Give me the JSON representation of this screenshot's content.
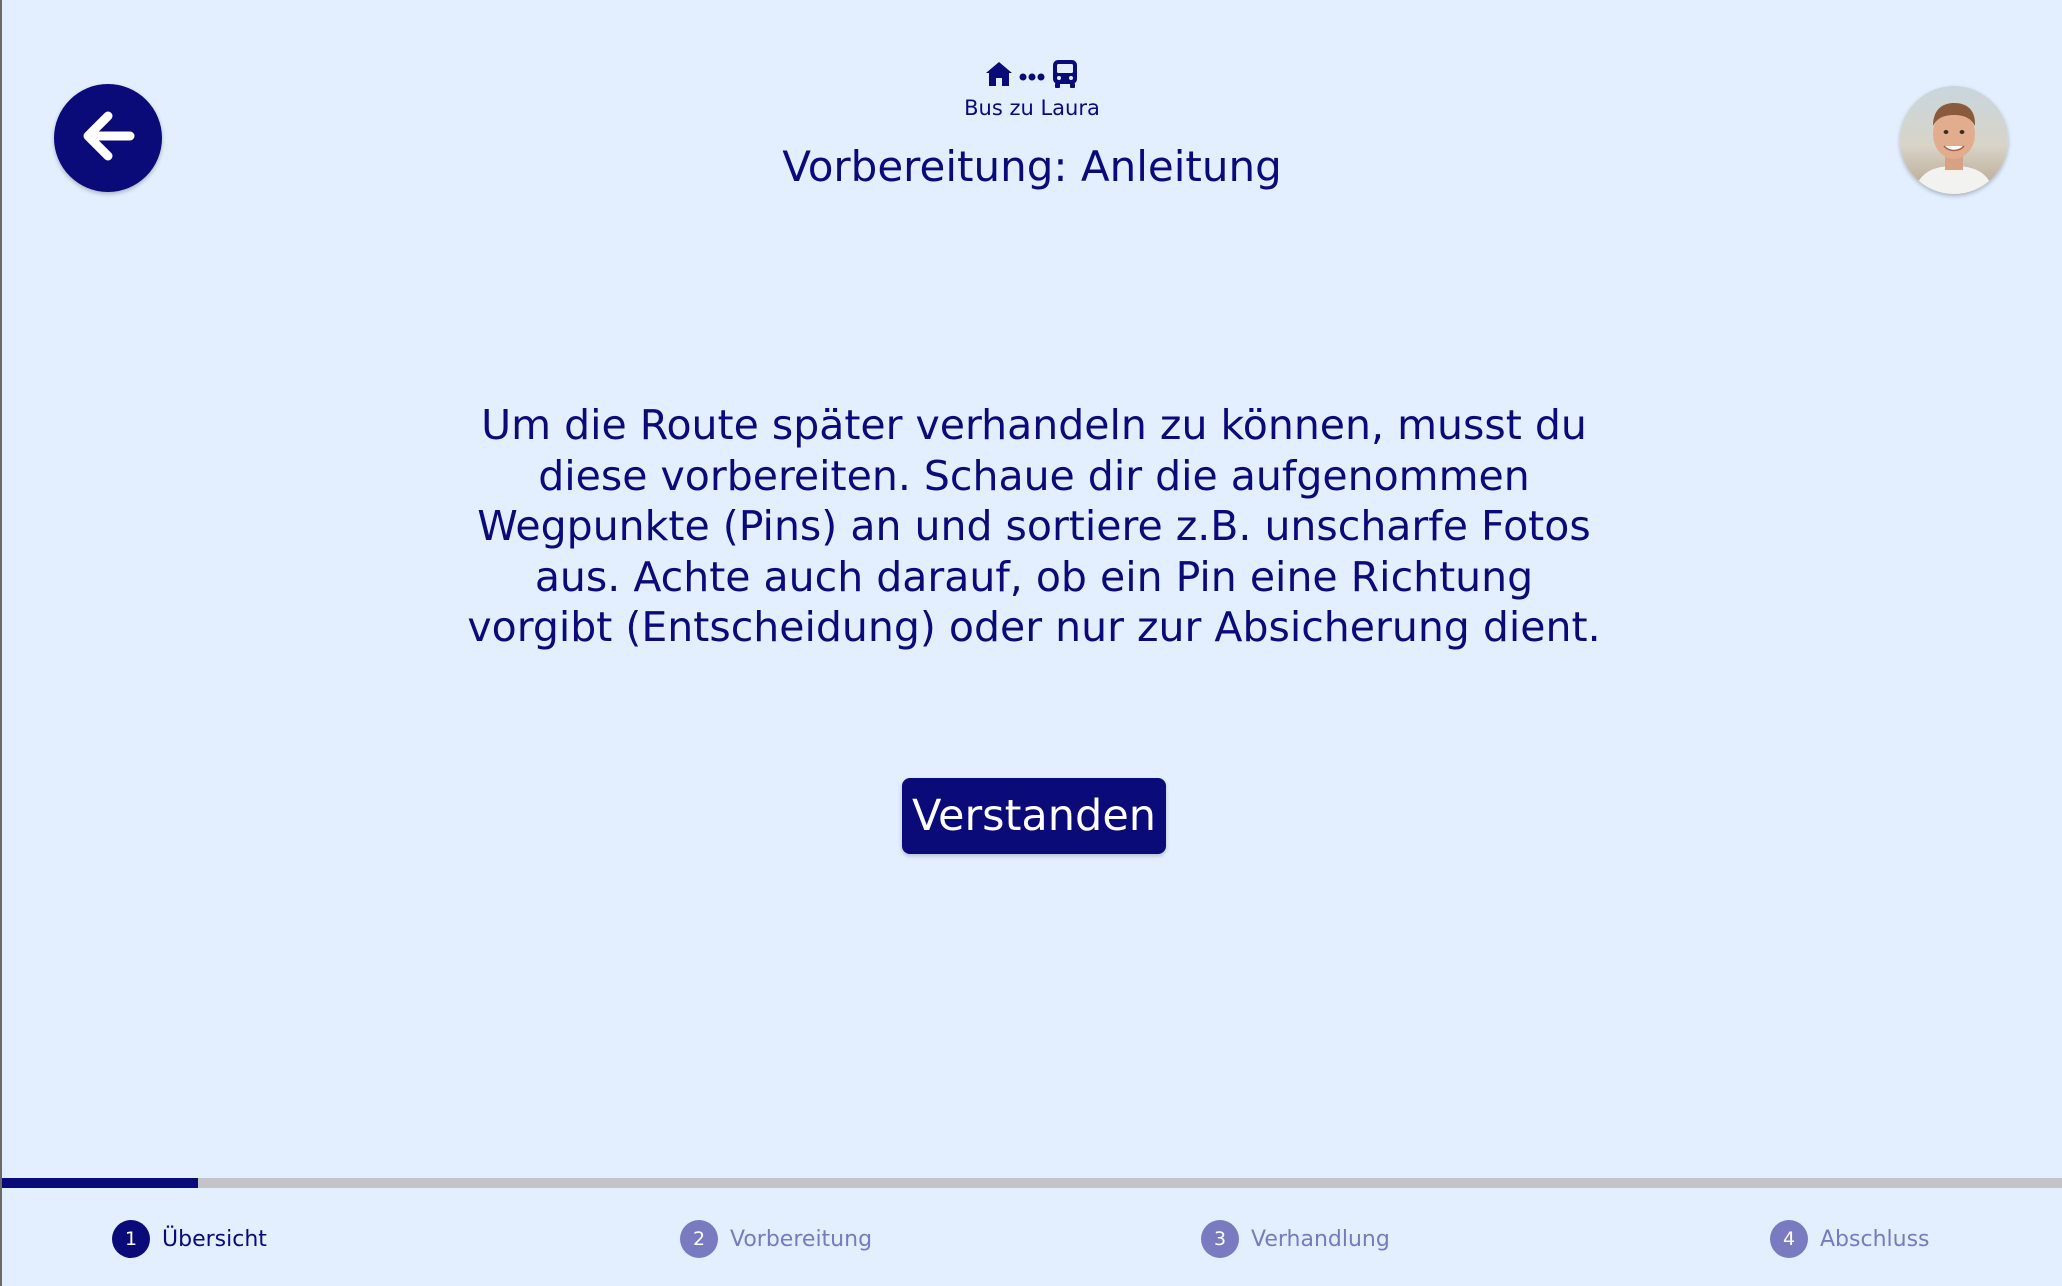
{
  "header": {
    "trip_name": "Bus zu Laura",
    "title": "Vorbereitung: Anleitung",
    "trip_icons": [
      "home-icon",
      "dots-icon",
      "bus-icon"
    ]
  },
  "content": {
    "instruction": "Um die Route später verhandeln zu können, musst du diese vorbereiten. Schaue dir die aufgenommen Wegpunkte (Pins) an und sortiere z.B. unscharfe Fotos aus. Achte auch darauf, ob ein Pin eine Richtung vorgibt (Entscheidung) oder nur zur Absicherung dient.",
    "confirm_label": "Verstanden"
  },
  "progress": {
    "fraction": 0.095,
    "steps": [
      {
        "number": "1",
        "label": "Übersicht",
        "active": true
      },
      {
        "number": "2",
        "label": "Vorbereitung",
        "active": false
      },
      {
        "number": "3",
        "label": "Verhandlung",
        "active": false
      },
      {
        "number": "4",
        "label": "Abschluss",
        "active": false
      }
    ]
  },
  "colors": {
    "background": "#e3effe",
    "primary": "#0a0a78",
    "inactive": "#7a7ac0",
    "track": "#c3c3c8"
  }
}
